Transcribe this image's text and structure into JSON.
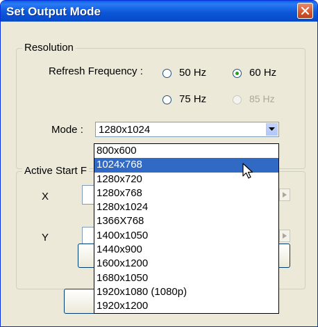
{
  "window": {
    "title": "Set Output Mode",
    "close_icon": "close-icon"
  },
  "resolution": {
    "legend": "Resolution",
    "refresh_label": "Refresh Frequency :",
    "options": [
      {
        "label": "50 Hz",
        "checked": false,
        "enabled": true
      },
      {
        "label": "60 Hz",
        "checked": true,
        "enabled": true
      },
      {
        "label": "75 Hz",
        "checked": false,
        "enabled": true
      },
      {
        "label": "85 Hz",
        "checked": false,
        "enabled": false
      }
    ],
    "mode_label": "Mode :",
    "mode_value": "1280x1024"
  },
  "active_start": {
    "legend": "Active Start F",
    "x_label": "X",
    "y_label": "Y"
  },
  "dropdown": {
    "items": [
      "800x600",
      "1024x768",
      "1280x720",
      "1280x768",
      "1280x1024",
      "1366X768",
      "1400x1050",
      "1440x900",
      "1600x1200",
      "1680x1050",
      "1920x1080 (1080p)",
      "1920x1200"
    ],
    "highlighted_index": 1
  },
  "colors": {
    "titlebar": "#0a5fdf",
    "selection": "#316ac5",
    "dialog_bg": "#ece9d8"
  }
}
